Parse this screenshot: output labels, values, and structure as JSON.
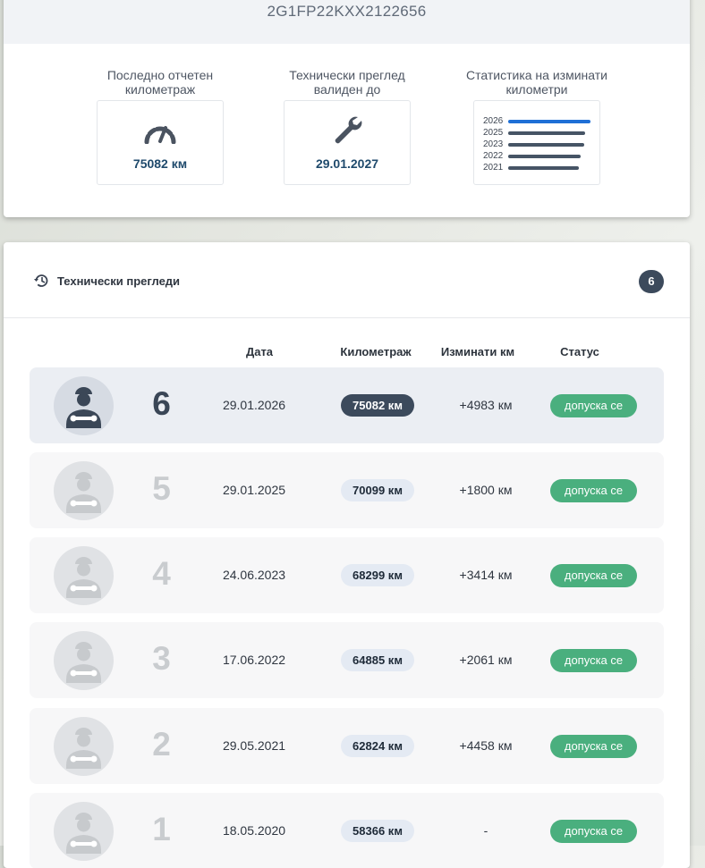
{
  "vehicle": {
    "vin": "2G1FP22KXX2122656"
  },
  "stats": {
    "last_km": {
      "label": "Последно отчетен километраж",
      "value": "75082 км",
      "icon": "speedometer-icon"
    },
    "inspection": {
      "label": "Технически преглед валиден до",
      "value": "29.01.2027",
      "icon": "wrench-icon"
    },
    "mileage": {
      "label": "Статистика на изминати километри",
      "icon": "bar-chart-icon",
      "rows": [
        {
          "year": "2026",
          "fraction": 1.0,
          "color": "#1f6fd6"
        },
        {
          "year": "2025",
          "fraction": 0.94,
          "color": "#465465"
        },
        {
          "year": "2023",
          "fraction": 0.92,
          "color": "#465465"
        },
        {
          "year": "2022",
          "fraction": 0.88,
          "color": "#465465"
        },
        {
          "year": "2021",
          "fraction": 0.86,
          "color": "#465465"
        }
      ]
    }
  },
  "inspections": {
    "title": "Технически прегледи",
    "count": "6",
    "columns": {
      "date": "Дата",
      "km": "Километраж",
      "diff": "Изминати км",
      "status": "Статус"
    },
    "rows": [
      {
        "num": "6",
        "date": "29.01.2026",
        "km": "75082 км",
        "diff": "+4983 км",
        "status": "допуска се"
      },
      {
        "num": "5",
        "date": "29.01.2025",
        "km": "70099 км",
        "diff": "+1800 км",
        "status": "допуска се"
      },
      {
        "num": "4",
        "date": "24.06.2023",
        "km": "68299 км",
        "diff": "+3414 км",
        "status": "допуска се"
      },
      {
        "num": "3",
        "date": "17.06.2022",
        "km": "64885 км",
        "diff": "+2061 км",
        "status": "допуска се"
      },
      {
        "num": "2",
        "date": "29.05.2021",
        "km": "62824 км",
        "diff": "+4458 км",
        "status": "допуска се"
      },
      {
        "num": "1",
        "date": "18.05.2020",
        "km": "58366 км",
        "diff": "-",
        "status": "допуска се"
      }
    ]
  },
  "colors": {
    "accent": "#1f6fd6",
    "dark": "#3c4a5c",
    "success": "#4aaf7e"
  }
}
